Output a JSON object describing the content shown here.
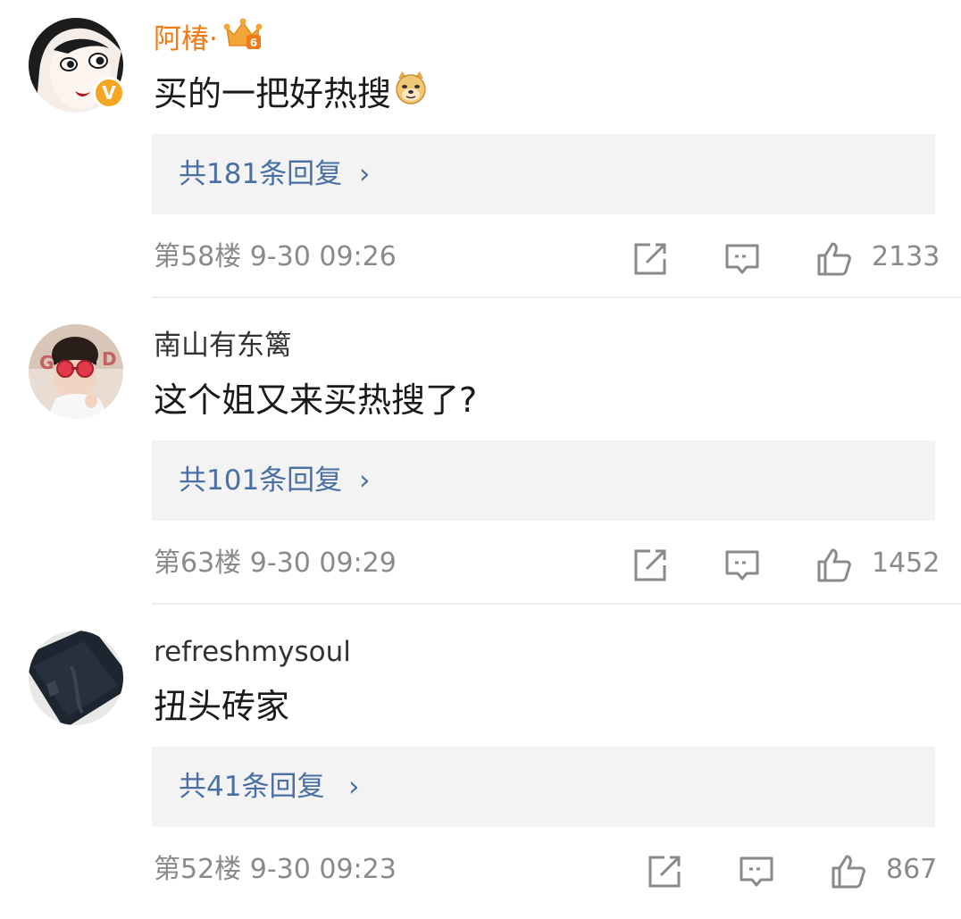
{
  "colors": {
    "vip_name": "#f07a13",
    "reply_link": "#4a6fa5",
    "meta_text": "#8a8a8a",
    "reply_bg": "#f3f3f3",
    "verified_badge": "#f5a623"
  },
  "comments": [
    {
      "username": "阿椿·",
      "vip": true,
      "verified": true,
      "badge_icon": "crown-vip-icon",
      "content": "买的一把好热搜",
      "content_emoji": "doge-emoji",
      "replies_label": "共181条回复",
      "replies_chevron": "›",
      "floor": "第58楼",
      "time": "9-30 09:26",
      "likes": "2133"
    },
    {
      "username": "南山有东篱",
      "vip": false,
      "verified": false,
      "content": "这个姐又来买热搜了?",
      "replies_label": "共101条回复",
      "replies_chevron": "›",
      "floor": "第63楼",
      "time": "9-30 09:29",
      "likes": "1452"
    },
    {
      "username": "refreshmysoul",
      "vip": false,
      "verified": false,
      "content": "扭头砖家",
      "replies_label": "共41条回复",
      "replies_chevron": "›",
      "floor": "第52楼",
      "time": "9-30 09:23",
      "likes": "867"
    }
  ]
}
